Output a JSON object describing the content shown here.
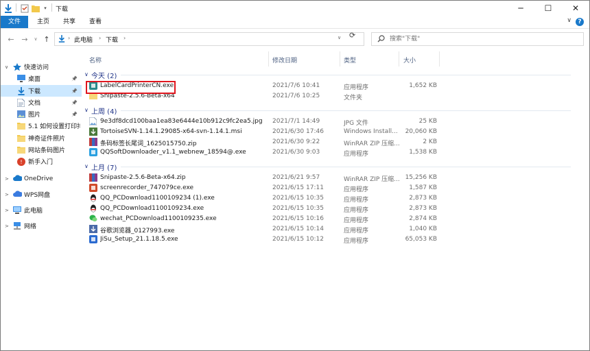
{
  "window": {
    "title": "下载",
    "controls": [
      "─",
      "☐",
      "✕"
    ]
  },
  "ribbon": {
    "tabs": [
      "文件",
      "主页",
      "共享",
      "查看"
    ],
    "help": "?"
  },
  "navbar": {
    "breadcrumb": [
      "此电脑",
      "下载"
    ],
    "search_placeholder": "搜索\"下载\""
  },
  "sidebar": {
    "items": [
      {
        "label": "快速访问",
        "icon": "star-icon",
        "color": "#1979ca",
        "expand": "∨",
        "pinned": false
      },
      {
        "label": "桌面",
        "icon": "desktop-icon",
        "color": "#3a8ee6",
        "pinned": true
      },
      {
        "label": "下载",
        "icon": "download-icon",
        "color": "#1979ca",
        "pinned": true,
        "selected": true
      },
      {
        "label": "文档",
        "icon": "document-icon",
        "color": "#7a8ea8",
        "pinned": true
      },
      {
        "label": "图片",
        "icon": "pictures-icon",
        "color": "#5b8fd6",
        "pinned": true
      },
      {
        "label": "5.1 如何设置打印排",
        "icon": "folder-icon",
        "color": "#f2c94c",
        "pinned": false
      },
      {
        "label": "神奇证件照片",
        "icon": "folder-icon",
        "color": "#f2c94c",
        "pinned": false
      },
      {
        "label": "网站条码图片",
        "icon": "folder-icon",
        "color": "#f2c94c",
        "pinned": false
      },
      {
        "label": "新手入门",
        "icon": "app-icon",
        "color": "#d9412a",
        "pinned": false
      },
      {
        "label": "OneDrive",
        "icon": "cloud-icon",
        "color": "#1979ca",
        "expand": ">",
        "pinned": false
      },
      {
        "label": "WPS网盘",
        "icon": "cloud-icon",
        "color": "#3a7be0",
        "expand": ">",
        "pinned": false
      },
      {
        "label": "此电脑",
        "icon": "computer-icon",
        "color": "#3a8ee6",
        "expand": ">",
        "pinned": false
      },
      {
        "label": "网络",
        "icon": "network-icon",
        "color": "#3a8ee6",
        "expand": ">",
        "pinned": false
      }
    ]
  },
  "columns": [
    "名称",
    "修改日期",
    "类型",
    "大小"
  ],
  "groups": [
    {
      "label": "今天 (2)",
      "files": [
        {
          "name": "LabelCardPrinterCN.exe",
          "date": "2021/7/6 10:41",
          "type": "应用程序",
          "size": "1,652 KB",
          "icon": "app-exe-icon",
          "color": "#2a8a8a"
        },
        {
          "name": "Snipaste-2.5.6-Beta-x64",
          "date": "2021/7/6 10:25",
          "type": "文件夹",
          "size": "",
          "icon": "folder-icon",
          "color": "#f2c94c"
        }
      ]
    },
    {
      "label": "上周 (4)",
      "files": [
        {
          "name": "9e3df8dcd100baa1ea83e6444e10b912c9fc2ea5.jpg",
          "date": "2021/7/1 14:49",
          "type": "JPG 文件",
          "size": "25 KB",
          "icon": "image-file-icon",
          "color": "#8a9bb0"
        },
        {
          "name": "TortoiseSVN-1.14.1.29085-x64-svn-1.14.1.msi",
          "date": "2021/6/30 17:46",
          "type": "Windows Install...",
          "size": "20,060 KB",
          "icon": "installer-icon",
          "color": "#4a7a3a"
        },
        {
          "name": "条码标签长尾词_1625015750.zip",
          "date": "2021/6/30 9:22",
          "type": "WinRAR ZIP 压缩...",
          "size": "2 KB",
          "icon": "zip-icon",
          "color": "#8a3a8a"
        },
        {
          "name": "QQSoftDownloader_v1.1_webnew_18594@.exe",
          "date": "2021/6/30 9:03",
          "type": "应用程序",
          "size": "1,538 KB",
          "icon": "app-exe-icon",
          "color": "#2aa0e0"
        }
      ]
    },
    {
      "label": "上月 (7)",
      "files": [
        {
          "name": "Snipaste-2.5.6-Beta-x64.zip",
          "date": "2021/6/21 9:57",
          "type": "WinRAR ZIP 压缩...",
          "size": "15,256 KB",
          "icon": "zip-icon",
          "color": "#8a3a8a"
        },
        {
          "name": "screenrecorder_747079ce.exe",
          "date": "2021/6/15 17:11",
          "type": "应用程序",
          "size": "1,587 KB",
          "icon": "app-exe-icon",
          "color": "#d04a2a"
        },
        {
          "name": "QQ_PCDownload1100109234 (1).exe",
          "date": "2021/6/15 10:35",
          "type": "应用程序",
          "size": "2,873 KB",
          "icon": "qq-icon",
          "color": "#222222"
        },
        {
          "name": "QQ_PCDownload1100109234.exe",
          "date": "2021/6/15 10:35",
          "type": "应用程序",
          "size": "2,873 KB",
          "icon": "qq-icon",
          "color": "#222222"
        },
        {
          "name": "wechat_PCDownload1100109235.exe",
          "date": "2021/6/15 10:16",
          "type": "应用程序",
          "size": "2,874 KB",
          "icon": "wechat-icon",
          "color": "#2bb34a"
        },
        {
          "name": "谷歌浏览器_0127993.exe",
          "date": "2021/6/15 10:14",
          "type": "应用程序",
          "size": "1,040 KB",
          "icon": "installer-icon",
          "color": "#4a6aa8"
        },
        {
          "name": "JiSu_Setup_21.1.18.5.exe",
          "date": "2021/6/15 10:12",
          "type": "应用程序",
          "size": "65,053 KB",
          "icon": "app-exe-icon",
          "color": "#2a6ad0"
        }
      ]
    }
  ]
}
